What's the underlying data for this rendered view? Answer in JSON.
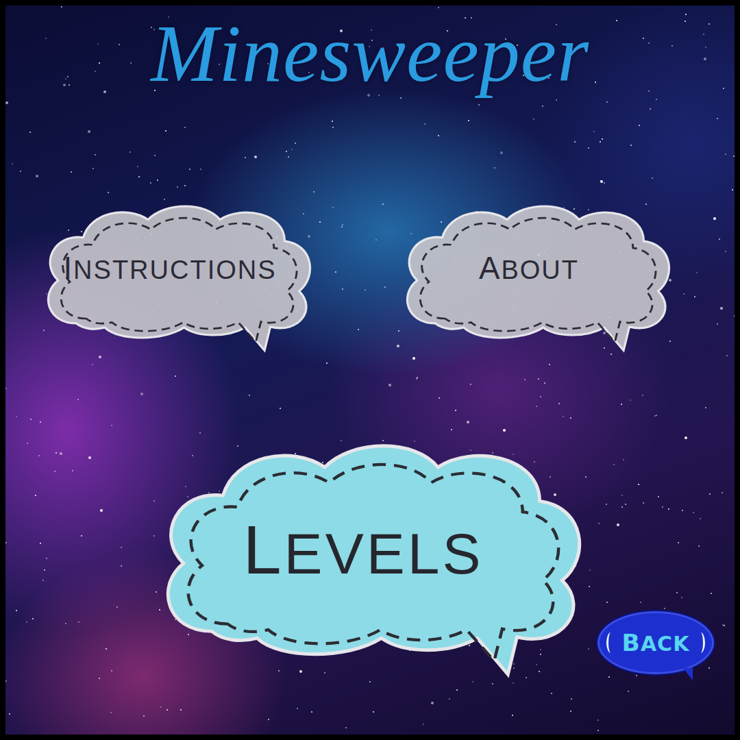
{
  "title": "Minesweeper",
  "menu": [
    {
      "label": "INSTRUCTIONS"
    },
    {
      "label": "ABOUT"
    }
  ],
  "primary": {
    "label": "LEVELS"
  },
  "back": {
    "label": "BACK"
  }
}
